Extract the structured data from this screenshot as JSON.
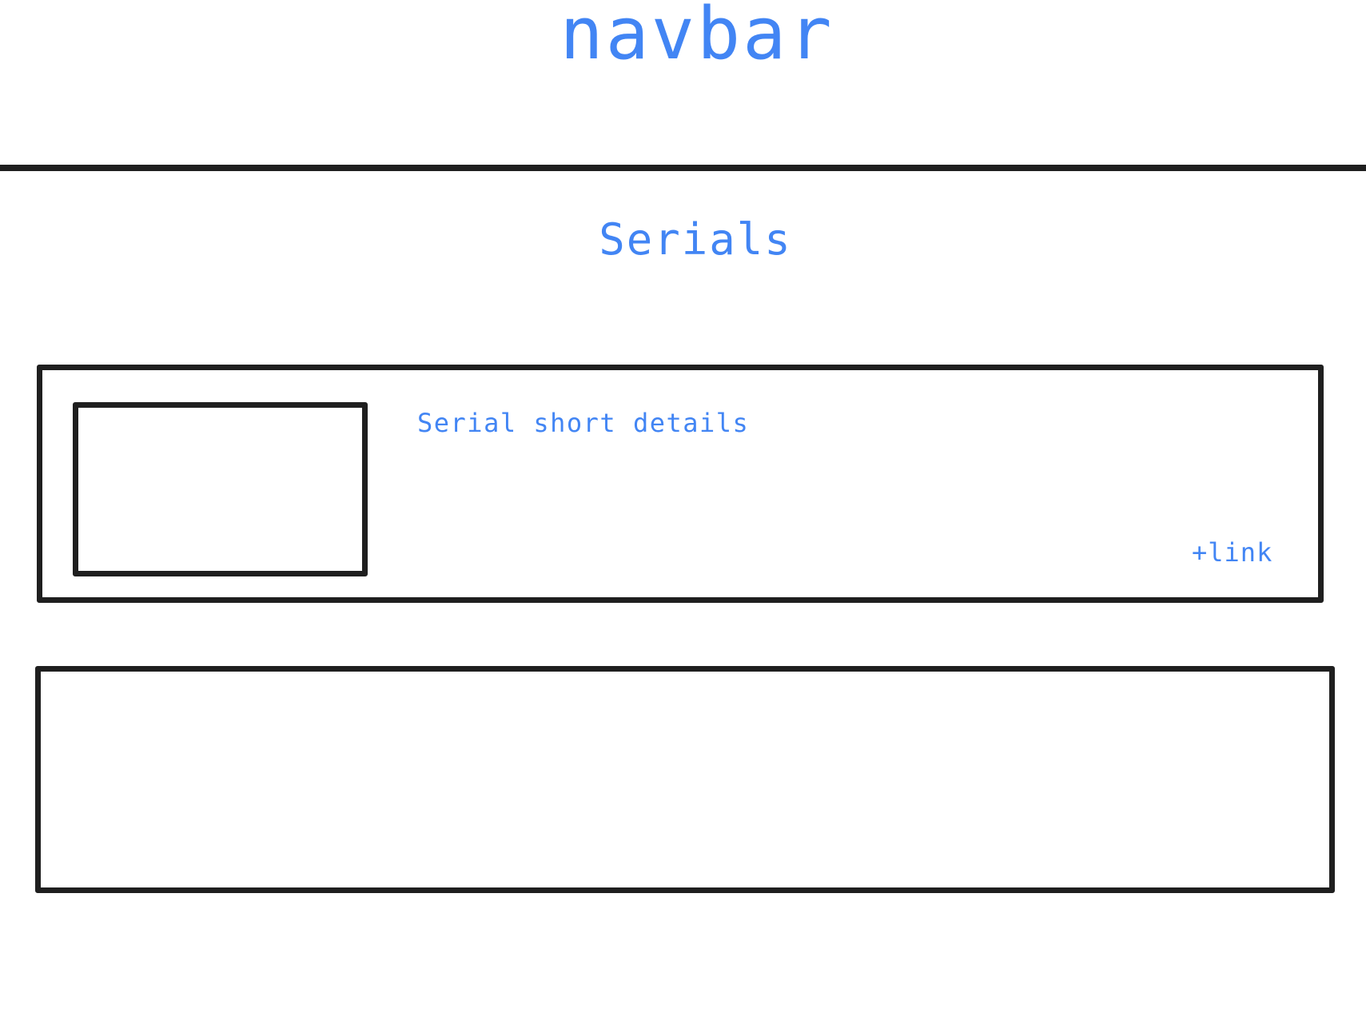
{
  "navbar": {
    "label": "navbar"
  },
  "page": {
    "title": "Serials"
  },
  "serials": [
    {
      "details": "Serial short details",
      "link_label": "+link"
    },
    {}
  ]
}
